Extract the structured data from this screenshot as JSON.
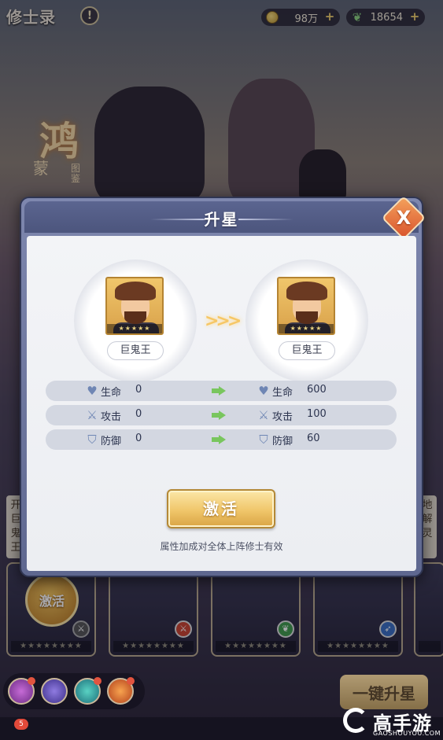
{
  "header": {
    "title": "修士录",
    "help_glyph": "!"
  },
  "resources": [
    {
      "icon": "coin-icon",
      "value": "98万",
      "plus": "+"
    },
    {
      "icon": "leaf-icon",
      "value": "18654",
      "plus": "+"
    }
  ],
  "emblem": {
    "big": "鸿",
    "small": "蒙",
    "small2": "图鉴"
  },
  "modal": {
    "title": "升星",
    "close_glyph": "X",
    "before": {
      "name": "巨鬼王",
      "stars": "★★★★★"
    },
    "after": {
      "name": "巨鬼王",
      "stars": "★★★★★"
    },
    "arrows": ">>>",
    "stats": [
      {
        "icon": "heart-icon",
        "label": "生命",
        "from": "0",
        "to": "600"
      },
      {
        "icon": "sword-icon",
        "label": "攻击",
        "from": "0",
        "to": "100"
      },
      {
        "icon": "shield-icon",
        "label": "防御",
        "from": "0",
        "to": "60"
      }
    ],
    "activate_label": "激活",
    "hint": "属性加成对全体上阵修士有效"
  },
  "background_cards": {
    "activate_bubble": "激活",
    "stars": "★★★★★★★★",
    "side_left": "开巨鬼王",
    "side_right": "地解灵"
  },
  "bottom": {
    "one_key_label": "一键升星",
    "badge_count": "5"
  },
  "watermark": {
    "text": "高手游",
    "url": "GAOSHOUYOU.COM"
  },
  "colors": {
    "accent_gold": "#f0c66a",
    "modal_header": "#5b6590",
    "stat_arrow": "#79c65e",
    "close": "#d9532c"
  }
}
